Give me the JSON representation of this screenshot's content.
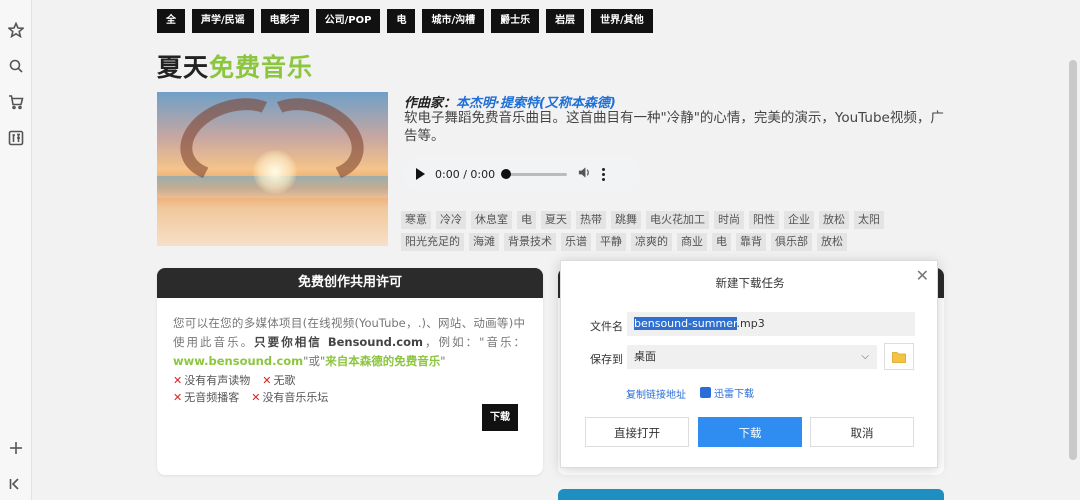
{
  "categories": [
    "全",
    "声学/民谣",
    "电影字",
    "公司/POP",
    "电",
    "城市/沟槽",
    "爵士乐",
    "岩层",
    "世界/其他"
  ],
  "title": {
    "part1": "夏天",
    "part2": "免费音乐"
  },
  "composer": {
    "label": "作曲家：",
    "name": "本杰明·提索特(又称本森德)"
  },
  "description": "软电子舞蹈免费音乐曲目。这首曲目有一种\"冷静\"的心情，完美的演示，YouTube视频，广告等。",
  "audio": {
    "time": "0:00 / 0:00",
    "progress": 0
  },
  "tags": [
    "寒意",
    "冷冷",
    "休息室",
    "电",
    "夏天",
    "热带",
    "跳舞",
    "电火花加工",
    "时尚",
    "阳性",
    "企业",
    "放松",
    "太阳",
    "阳光充足的",
    "海滩",
    "背景技术",
    "乐谱",
    "平静",
    "凉爽的",
    "商业",
    "电",
    "靠背",
    "俱乐部",
    "放松"
  ],
  "license": {
    "header": "免费创作共用许可",
    "text_normal": "您可以在您的多媒体项目(在线视频(YouTube，.)、网站、动画等)中使用此音乐。",
    "text_bold": "只要你相信 Bensound.com",
    "text_after": "，例如：\"音乐：",
    "text_green1": "www.bensound.com",
    "text_mid": "\"或\"",
    "text_green2": "来自本森德的免费音乐",
    "text_end": "\"",
    "restrictions": [
      [
        "没有有声读物",
        "无歌"
      ],
      [
        "无音频播客",
        "没有音乐乐坛"
      ]
    ],
    "download_label": "下载"
  },
  "dialog": {
    "title": "新建下载任务",
    "filename_label": "文件名",
    "filename_selected": "bensound-summer",
    "filename_rest": ".mp3",
    "save_to_label": "保存到",
    "save_to_value": "桌面",
    "copy_link": "复制链接地址",
    "xunlei": "迅雷下载",
    "btn_open": "直接打开",
    "btn_download": "下载",
    "btn_cancel": "取消"
  },
  "colors": {
    "accent_green": "#8cc63e",
    "link_blue": "#2a6dd9",
    "primary_button": "#2f8cf0",
    "danger": "#e02222"
  }
}
